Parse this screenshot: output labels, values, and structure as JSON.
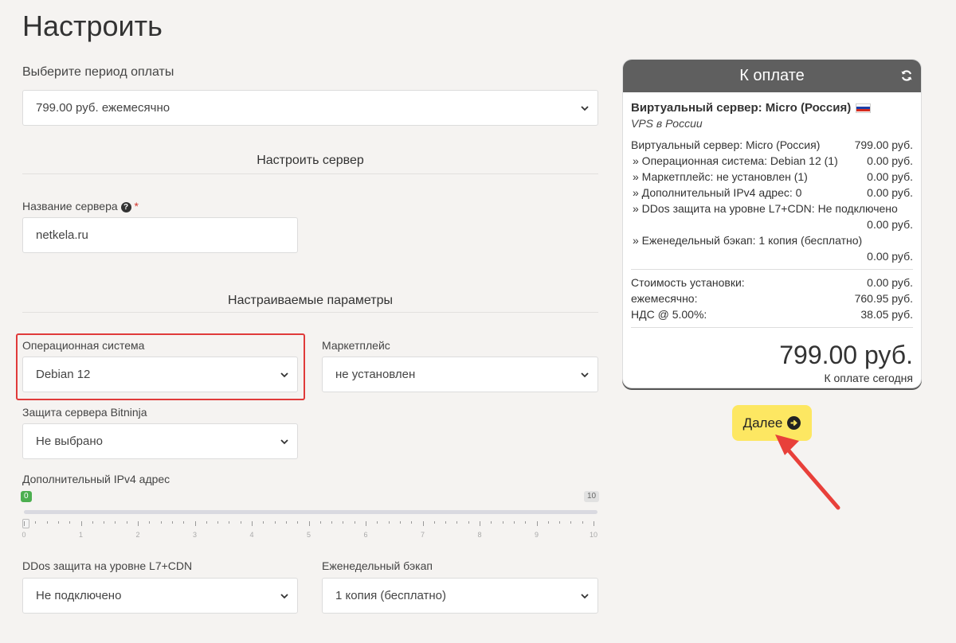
{
  "page": {
    "title": "Настроить"
  },
  "billing": {
    "label": "Выберите период оплаты",
    "selected": "799.00 руб. ежемесячно"
  },
  "server_section": {
    "title": "Настроить сервер",
    "name_label": "Название сервера",
    "name_required": "*",
    "name_value": "netkela.ru"
  },
  "params_section": {
    "title": "Настраиваемые параметры",
    "os": {
      "label": "Операционная система",
      "selected": "Debian 12"
    },
    "marketplace": {
      "label": "Маркетплейс",
      "selected": "не установлен"
    },
    "bitninja": {
      "label": "Защита сервера Bitninja",
      "selected": "Не выбрано"
    },
    "ipv4": {
      "label": "Дополнительный IPv4 адрес",
      "value": 0,
      "min": 0,
      "max": 10,
      "min_label": "0",
      "max_label": "10",
      "ticks": [
        "0",
        "1",
        "2",
        "3",
        "4",
        "5",
        "6",
        "7",
        "8",
        "9",
        "10"
      ]
    },
    "ddos": {
      "label": "DDos защита на уровне L7+CDN",
      "selected": "Не подключено"
    },
    "backup": {
      "label": "Еженедельный бэкап",
      "selected": "1 копия (бесплатно)"
    }
  },
  "summary": {
    "header": "К оплате",
    "product_name": "Виртуальный сервер: Micro (Россия)",
    "product_group": "VPS в России",
    "lines": [
      {
        "label": "Виртуальный сервер: Micro (Россия)",
        "price": "799.00 руб."
      },
      {
        "label": "» Операционная система: Debian 12 (1)",
        "price": "0.00 руб."
      },
      {
        "label": "» Маркетплейс: не установлен (1)",
        "price": "0.00 руб."
      },
      {
        "label": "» Дополнительный IPv4 адрес: 0",
        "price": "0.00 руб."
      }
    ],
    "line_ddos_label": "» DDos защита на уровне L7+CDN: Не подключено",
    "line_ddos_price": "0.00 руб.",
    "line_backup_label": "» Еженедельный бэкап: 1 копия (бесплатно)",
    "line_backup_price": "0.00 руб.",
    "totals": [
      {
        "label": "Стоимость установки:",
        "price": "0.00 руб."
      },
      {
        "label": "ежемесячно:",
        "price": "760.95 руб."
      },
      {
        "label": "НДС @ 5.00%:",
        "price": "38.05 руб."
      }
    ],
    "total_amount": "799.00 руб.",
    "total_label": "К оплате сегодня"
  },
  "next_button": {
    "label": "Далее"
  },
  "colors": {
    "accent_button": "#fde762",
    "card_header": "#5f5f5f",
    "highlight_box": "#e03a3a",
    "annotation_arrow": "#e8403a",
    "slider_min": "#4caf50"
  }
}
